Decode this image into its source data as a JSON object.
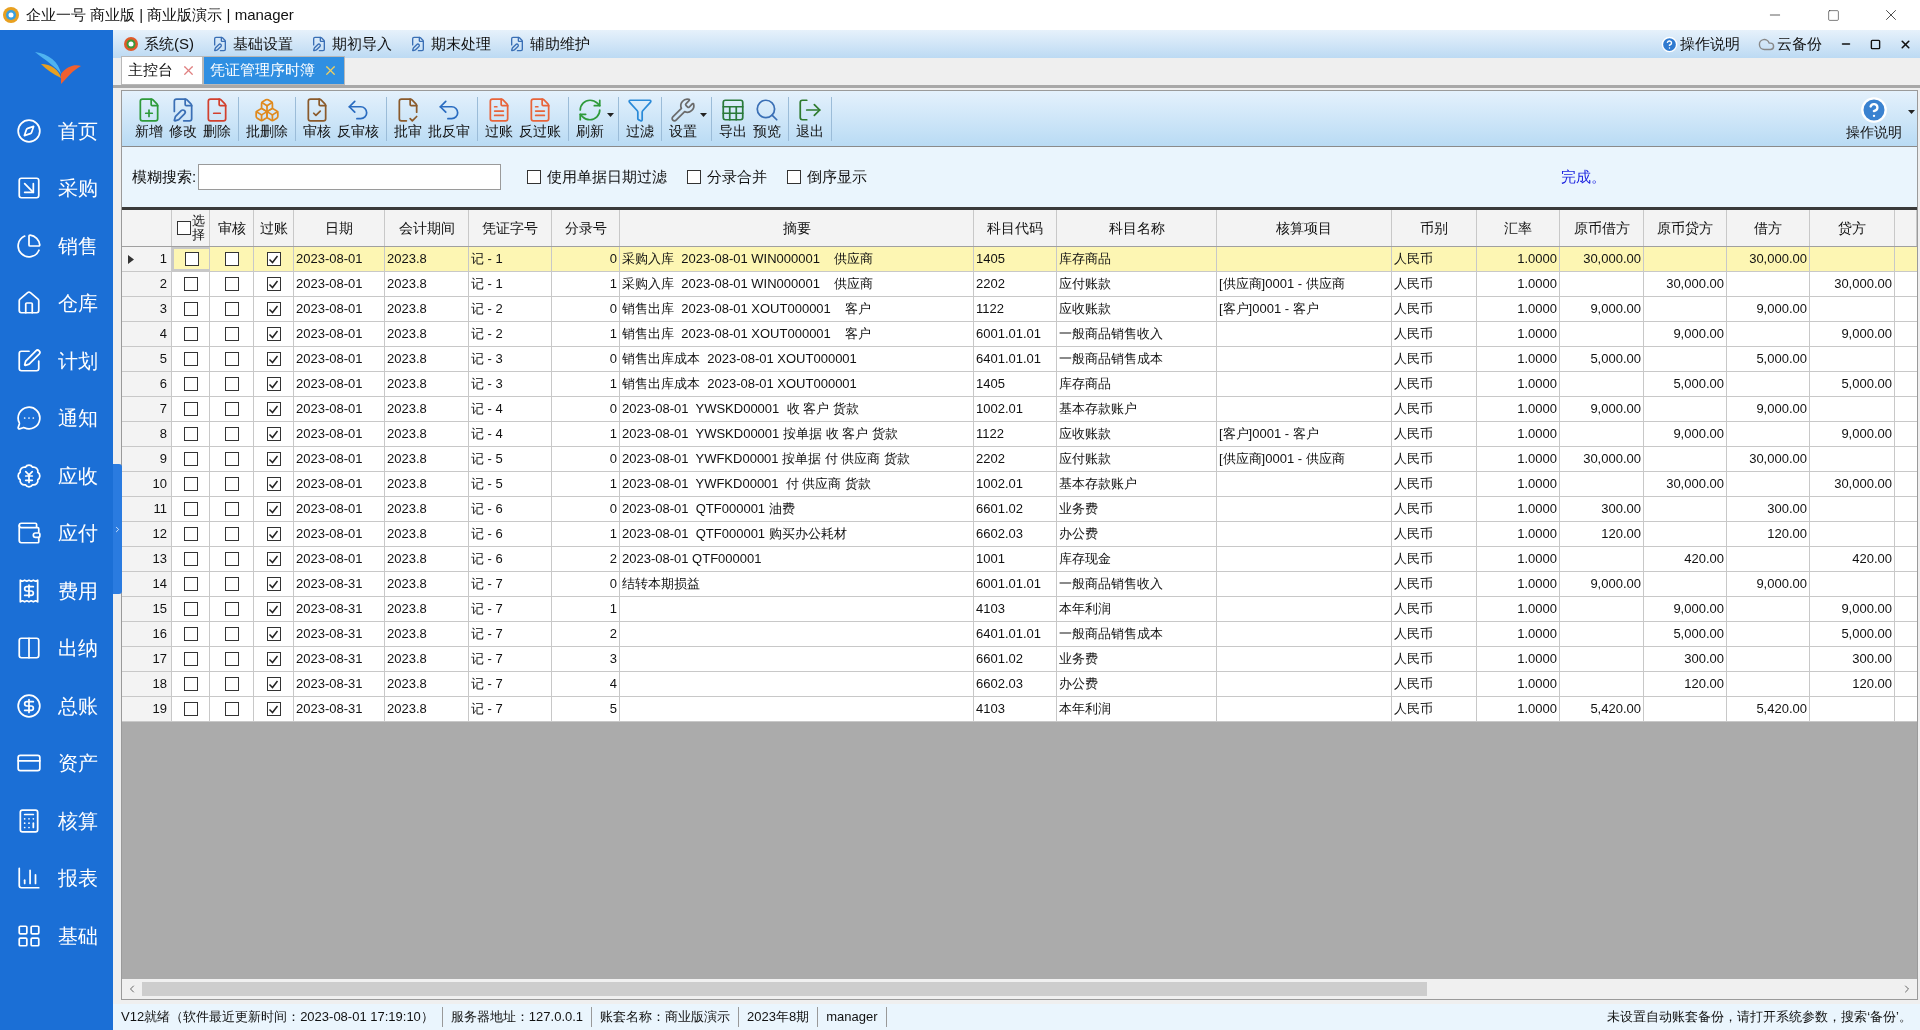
{
  "window": {
    "title": "企业一号 商业版 | 商业版演示 | manager"
  },
  "sidebar": {
    "items": [
      {
        "label": "首页"
      },
      {
        "label": "采购"
      },
      {
        "label": "销售"
      },
      {
        "label": "仓库"
      },
      {
        "label": "计划"
      },
      {
        "label": "通知"
      },
      {
        "label": "应收"
      },
      {
        "label": "应付"
      },
      {
        "label": "费用"
      },
      {
        "label": "出纳"
      },
      {
        "label": "总账"
      },
      {
        "label": "资产"
      },
      {
        "label": "核算"
      },
      {
        "label": "报表"
      },
      {
        "label": "基础"
      }
    ]
  },
  "menu": {
    "items": [
      "系统(S)",
      "基础设置",
      "期初导入",
      "期末处理",
      "辅助维护"
    ],
    "right": [
      "操作说明",
      "云备份"
    ]
  },
  "tabs": [
    {
      "label": "主控台",
      "selected": false
    },
    {
      "label": "凭证管理序时簿",
      "selected": true
    }
  ],
  "toolbar": {
    "groups": [
      [
        "新增",
        "修改",
        "删除"
      ],
      [
        "批删除"
      ],
      [
        "审核",
        "反审核"
      ],
      [
        "批审",
        "批反审"
      ],
      [
        "过账",
        "反过账"
      ],
      [
        "刷新"
      ],
      [
        "过滤"
      ],
      [
        "设置"
      ],
      [
        "导出",
        "预览"
      ],
      [
        "退出"
      ]
    ],
    "help": "操作说明"
  },
  "search": {
    "label": "模糊搜索:",
    "options": [
      {
        "label": "使用单据日期过滤",
        "checked": false
      },
      {
        "label": "分录合并",
        "checked": false
      },
      {
        "label": "倒序显示",
        "checked": false
      }
    ],
    "status": "完成。"
  },
  "table": {
    "select_all": false,
    "columns": [
      "选择",
      "审核",
      "过账",
      "日期",
      "会计期间",
      "凭证字号",
      "分录号",
      "摘要",
      "科目代码",
      "科目名称",
      "核算项目",
      "币别",
      "汇率",
      "原币借方",
      "原币贷方",
      "借方",
      "贷方"
    ],
    "rows": [
      {
        "no": "1",
        "selected": true,
        "picked": false,
        "audited": false,
        "posted": true,
        "date": "2023-08-01",
        "period": "2023.8",
        "voucher": "记 - 1",
        "entry": "0",
        "summary": "采购入库  2023-08-01 WIN000001    供应商",
        "code": "1405",
        "account": "库存商品",
        "currency": "人民币",
        "rate": "1.0000",
        "fc_debit": "30,000.00",
        "debit": "30,000.00"
      },
      {
        "no": "2",
        "selected": false,
        "picked": false,
        "audited": false,
        "posted": true,
        "date": "2023-08-01",
        "period": "2023.8",
        "voucher": "记 - 1",
        "entry": "1",
        "summary": "采购入库  2023-08-01 WIN000001    供应商",
        "code": "2202",
        "account": "应付账款",
        "item": "[供应商]0001 - 供应商",
        "currency": "人民币",
        "rate": "1.0000",
        "fc_credit": "30,000.00",
        "credit": "30,000.00"
      },
      {
        "no": "3",
        "selected": false,
        "picked": false,
        "audited": false,
        "posted": true,
        "date": "2023-08-01",
        "period": "2023.8",
        "voucher": "记 - 2",
        "entry": "0",
        "summary": "销售出库  2023-08-01 XOUT000001    客户",
        "code": "1122",
        "account": "应收账款",
        "item": "[客户]0001 - 客户",
        "currency": "人民币",
        "rate": "1.0000",
        "fc_debit": "9,000.00",
        "debit": "9,000.00"
      },
      {
        "no": "4",
        "selected": false,
        "picked": false,
        "audited": false,
        "posted": true,
        "date": "2023-08-01",
        "period": "2023.8",
        "voucher": "记 - 2",
        "entry": "1",
        "summary": "销售出库  2023-08-01 XOUT000001    客户",
        "code": "6001.01.01",
        "account": "一般商品销售收入",
        "currency": "人民币",
        "rate": "1.0000",
        "fc_credit": "9,000.00",
        "credit": "9,000.00"
      },
      {
        "no": "5",
        "selected": false,
        "picked": false,
        "audited": false,
        "posted": true,
        "date": "2023-08-01",
        "period": "2023.8",
        "voucher": "记 - 3",
        "entry": "0",
        "summary": "销售出库成本  2023-08-01 XOUT000001",
        "code": "6401.01.01",
        "account": "一般商品销售成本",
        "currency": "人民币",
        "rate": "1.0000",
        "fc_debit": "5,000.00",
        "debit": "5,000.00"
      },
      {
        "no": "6",
        "selected": false,
        "picked": false,
        "audited": false,
        "posted": true,
        "date": "2023-08-01",
        "period": "2023.8",
        "voucher": "记 - 3",
        "entry": "1",
        "summary": "销售出库成本  2023-08-01 XOUT000001",
        "code": "1405",
        "account": "库存商品",
        "currency": "人民币",
        "rate": "1.0000",
        "fc_credit": "5,000.00",
        "credit": "5,000.00"
      },
      {
        "no": "7",
        "selected": false,
        "picked": false,
        "audited": false,
        "posted": true,
        "date": "2023-08-01",
        "period": "2023.8",
        "voucher": "记 - 4",
        "entry": "0",
        "summary": "2023-08-01  YWSKD00001  收 客户 货款",
        "code": "1002.01",
        "account": "基本存款账户",
        "currency": "人民币",
        "rate": "1.0000",
        "fc_debit": "9,000.00",
        "debit": "9,000.00"
      },
      {
        "no": "8",
        "selected": false,
        "picked": false,
        "audited": false,
        "posted": true,
        "date": "2023-08-01",
        "period": "2023.8",
        "voucher": "记 - 4",
        "entry": "1",
        "summary": "2023-08-01  YWSKD00001 按单据 收 客户 货款",
        "code": "1122",
        "account": "应收账款",
        "item": "[客户]0001 - 客户",
        "currency": "人民币",
        "rate": "1.0000",
        "fc_credit": "9,000.00",
        "credit": "9,000.00"
      },
      {
        "no": "9",
        "selected": false,
        "picked": false,
        "audited": false,
        "posted": true,
        "date": "2023-08-01",
        "period": "2023.8",
        "voucher": "记 - 5",
        "entry": "0",
        "summary": "2023-08-01  YWFKD00001 按单据 付 供应商 货款",
        "code": "2202",
        "account": "应付账款",
        "item": "[供应商]0001 - 供应商",
        "currency": "人民币",
        "rate": "1.0000",
        "fc_debit": "30,000.00",
        "debit": "30,000.00"
      },
      {
        "no": "10",
        "selected": false,
        "picked": false,
        "audited": false,
        "posted": true,
        "date": "2023-08-01",
        "period": "2023.8",
        "voucher": "记 - 5",
        "entry": "1",
        "summary": "2023-08-01  YWFKD00001  付 供应商 货款",
        "code": "1002.01",
        "account": "基本存款账户",
        "currency": "人民币",
        "rate": "1.0000",
        "fc_credit": "30,000.00",
        "credit": "30,000.00"
      },
      {
        "no": "11",
        "selected": false,
        "picked": false,
        "audited": false,
        "posted": true,
        "date": "2023-08-01",
        "period": "2023.8",
        "voucher": "记 - 6",
        "entry": "0",
        "summary": "2023-08-01  QTF000001 油费",
        "code": "6601.02",
        "account": "业务费",
        "currency": "人民币",
        "rate": "1.0000",
        "fc_debit": "300.00",
        "debit": "300.00"
      },
      {
        "no": "12",
        "selected": false,
        "picked": false,
        "audited": false,
        "posted": true,
        "date": "2023-08-01",
        "period": "2023.8",
        "voucher": "记 - 6",
        "entry": "1",
        "summary": "2023-08-01  QTF000001 购买办公耗材",
        "code": "6602.03",
        "account": "办公费",
        "currency": "人民币",
        "rate": "1.0000",
        "fc_debit": "120.00",
        "debit": "120.00"
      },
      {
        "no": "13",
        "selected": false,
        "picked": false,
        "audited": false,
        "posted": true,
        "date": "2023-08-01",
        "period": "2023.8",
        "voucher": "记 - 6",
        "entry": "2",
        "summary": "2023-08-01 QTF000001",
        "code": "1001",
        "account": "库存现金",
        "currency": "人民币",
        "rate": "1.0000",
        "fc_credit": "420.00",
        "credit": "420.00"
      },
      {
        "no": "14",
        "selected": false,
        "picked": false,
        "audited": false,
        "posted": true,
        "date": "2023-08-31",
        "period": "2023.8",
        "voucher": "记 - 7",
        "entry": "0",
        "summary": "结转本期损益",
        "code": "6001.01.01",
        "account": "一般商品销售收入",
        "currency": "人民币",
        "rate": "1.0000",
        "fc_debit": "9,000.00",
        "debit": "9,000.00"
      },
      {
        "no": "15",
        "selected": false,
        "picked": false,
        "audited": false,
        "posted": true,
        "date": "2023-08-31",
        "period": "2023.8",
        "voucher": "记 - 7",
        "entry": "1",
        "code": "4103",
        "account": "本年利润",
        "currency": "人民币",
        "rate": "1.0000",
        "fc_credit": "9,000.00",
        "credit": "9,000.00"
      },
      {
        "no": "16",
        "selected": false,
        "picked": false,
        "audited": false,
        "posted": true,
        "date": "2023-08-31",
        "period": "2023.8",
        "voucher": "记 - 7",
        "entry": "2",
        "code": "6401.01.01",
        "account": "一般商品销售成本",
        "currency": "人民币",
        "rate": "1.0000",
        "fc_credit": "5,000.00",
        "credit": "5,000.00"
      },
      {
        "no": "17",
        "selected": false,
        "picked": false,
        "audited": false,
        "posted": true,
        "date": "2023-08-31",
        "period": "2023.8",
        "voucher": "记 - 7",
        "entry": "3",
        "code": "6601.02",
        "account": "业务费",
        "currency": "人民币",
        "rate": "1.0000",
        "fc_credit": "300.00",
        "credit": "300.00"
      },
      {
        "no": "18",
        "selected": false,
        "picked": false,
        "audited": false,
        "posted": true,
        "date": "2023-08-31",
        "period": "2023.8",
        "voucher": "记 - 7",
        "entry": "4",
        "code": "6602.03",
        "account": "办公费",
        "currency": "人民币",
        "rate": "1.0000",
        "fc_credit": "120.00",
        "credit": "120.00"
      },
      {
        "no": "19",
        "selected": false,
        "picked": false,
        "audited": false,
        "posted": true,
        "date": "2023-08-31",
        "period": "2023.8",
        "voucher": "记 - 7",
        "entry": "5",
        "code": "4103",
        "account": "本年利润",
        "currency": "人民币",
        "rate": "1.0000",
        "fc_debit": "5,420.00",
        "debit": "5,420.00"
      }
    ]
  },
  "status_bar": [
    "V12就绪（软件最近更新时间：2023-08-01 17:19:10）",
    "服务器地址：127.0.0.1",
    "账套名称：商业版演示",
    "2023年8期",
    "manager",
    "未设置自动账套备份，请打开系统参数，搜索‘备份’。"
  ]
}
